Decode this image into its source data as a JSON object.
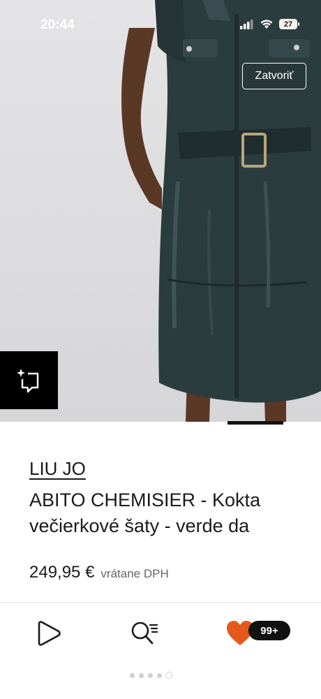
{
  "status_bar": {
    "time": "20:44",
    "battery": "27"
  },
  "close_button": {
    "label": "Zatvoriť"
  },
  "product": {
    "brand": "LIU JO",
    "name_line1": "ABITO CHEMISIER - Kokta",
    "name_line2": "večierkové šaty - verde da",
    "price": "249,95 €",
    "vat_note": "vrátane DPH"
  },
  "tab_bar": {
    "items": [
      {
        "icon": "play-icon"
      },
      {
        "icon": "search-list-icon"
      },
      {
        "icon": "heart-icon",
        "badge": "99+"
      }
    ]
  },
  "page_indicator": {
    "total": 5,
    "active": 5
  },
  "colors": {
    "accent_heart": "#e35a1c",
    "dress": "#2b3c3e",
    "background": "#ffffff"
  }
}
